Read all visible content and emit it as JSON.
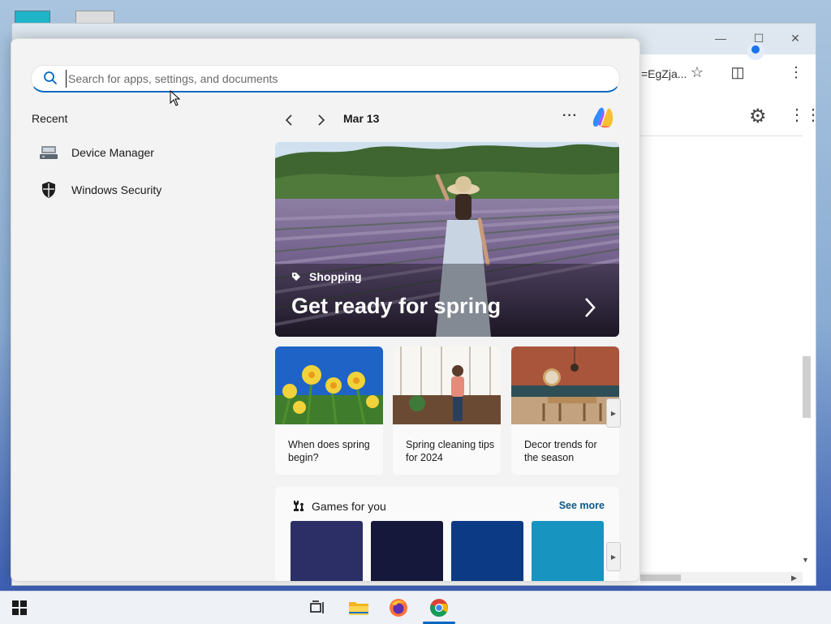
{
  "search": {
    "placeholder": "Search for apps, settings, and documents"
  },
  "recent": {
    "title": "Recent",
    "items": [
      {
        "label": "Device Manager",
        "icon": "device-manager-icon"
      },
      {
        "label": "Windows Security",
        "icon": "windows-security-icon"
      }
    ]
  },
  "widgets": {
    "date": "Mar 13",
    "hero": {
      "category": "Shopping",
      "title": "Get ready for spring"
    },
    "cards": [
      {
        "caption": "When does spring begin?"
      },
      {
        "caption": "Spring cleaning tips for 2024"
      },
      {
        "caption": "Decor trends for the season"
      }
    ],
    "games": {
      "title": "Games for you",
      "see_more": "See more",
      "tile_colors": [
        "#2c2f66",
        "#15183a",
        "#0d3a84",
        "#1795c0"
      ]
    }
  },
  "chrome": {
    "url_fragment": "=EgZja..."
  },
  "colors": {
    "accent": "#0067c0",
    "link": "#0a5a8a"
  }
}
